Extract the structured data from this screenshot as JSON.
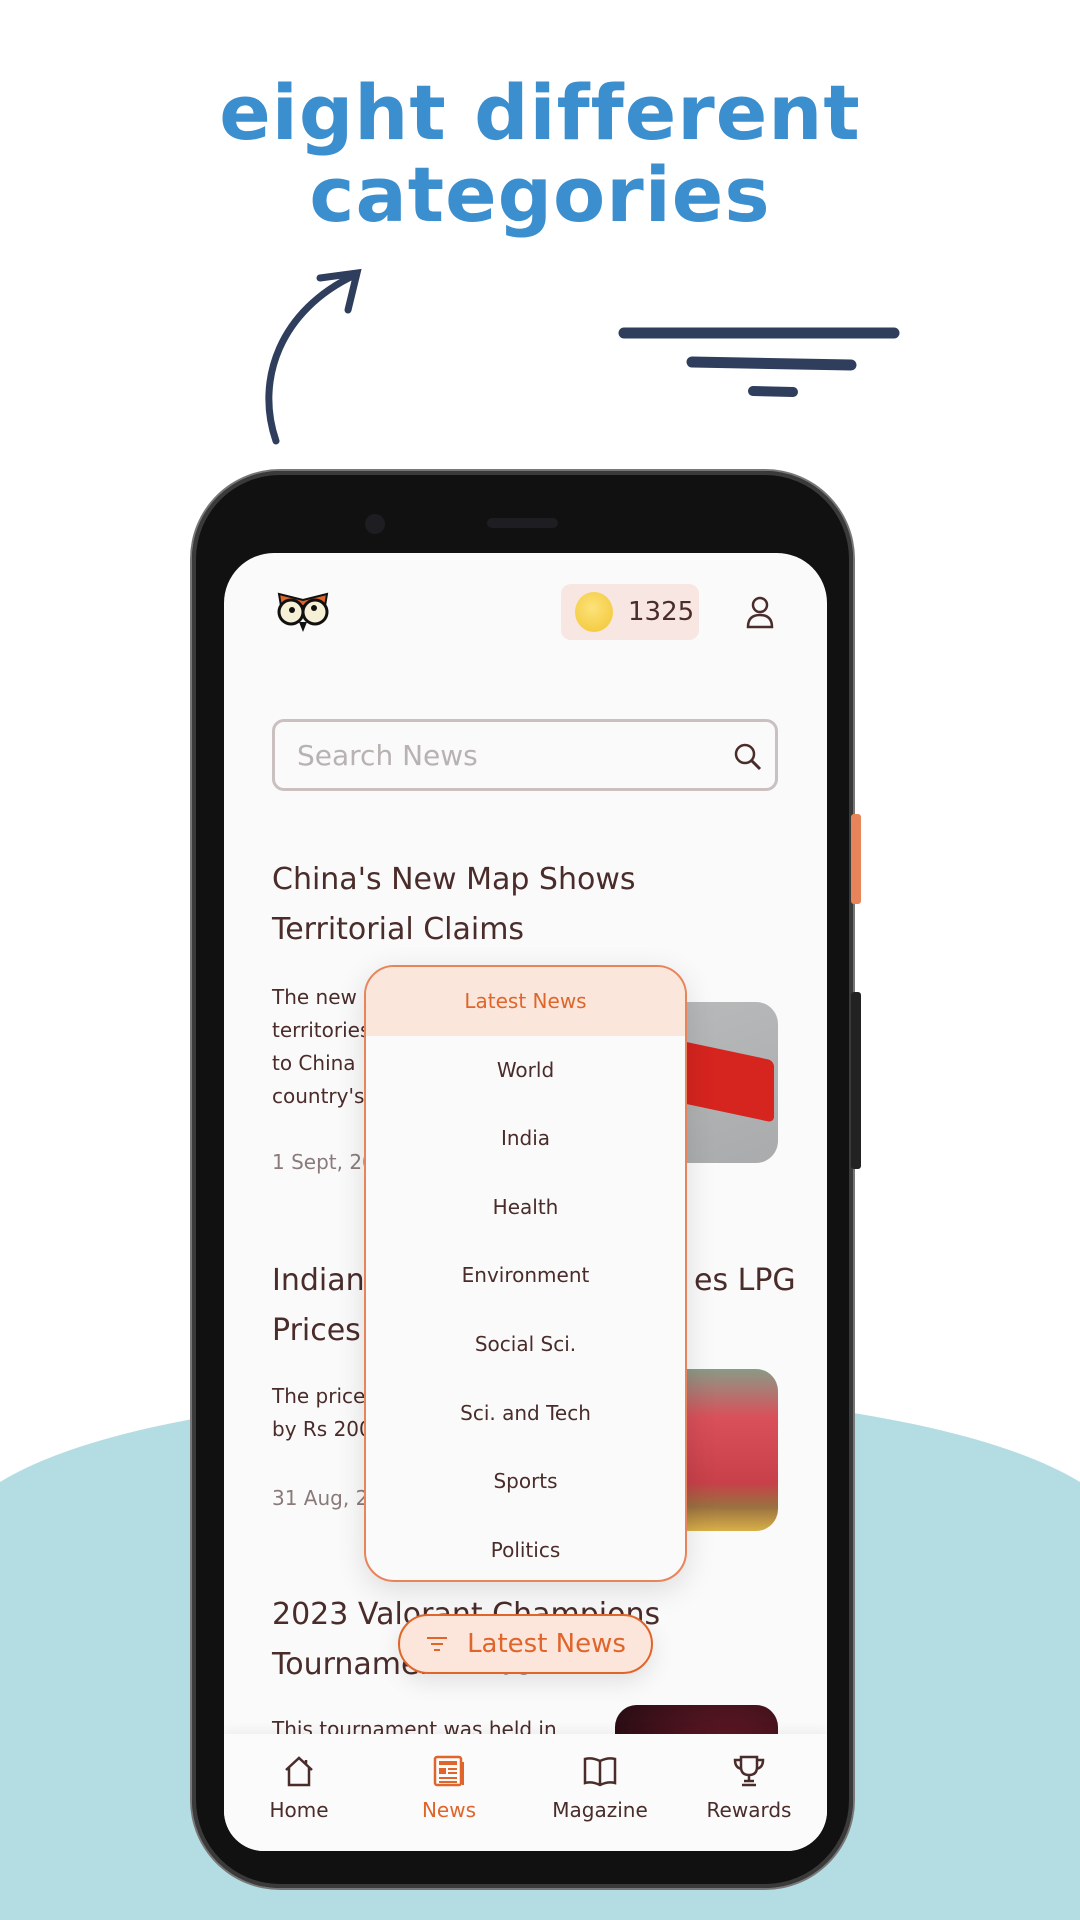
{
  "promo": {
    "headline_line1": "eight different",
    "headline_line2": "categories"
  },
  "app": {
    "coins": "1325",
    "search": {
      "placeholder": "Search News"
    },
    "articles": [
      {
        "title_lines": [
          "China's New Map Shows",
          "Territorial Claims"
        ],
        "body_lines": [
          "The new",
          "territories",
          "to China",
          "country's"
        ],
        "date": "1 Sept, 20"
      },
      {
        "title_lines": [
          "Indian",
          "es LPG",
          "Prices"
        ],
        "body_lines": [
          "The price",
          "by Rs 200"
        ],
        "date": "31 Aug, 2"
      },
      {
        "title_lines": [
          "2023 Valorant Champions",
          "Tournament Ends"
        ],
        "body_lines": [
          "This tournament was held in"
        ]
      }
    ],
    "category_menu": {
      "selected": "Latest News",
      "items": [
        "Latest News",
        "World",
        "India",
        "Health",
        "Environment",
        "Social Sci.",
        "Sci. and Tech",
        "Sports",
        "Politics"
      ]
    },
    "filter_button": {
      "label": "Latest News",
      "icon": "filter-icon"
    },
    "bottom_nav": [
      {
        "label": "Home",
        "icon": "home-icon"
      },
      {
        "label": "News",
        "icon": "newspaper-icon",
        "active": true
      },
      {
        "label": "Magazine",
        "icon": "book-icon"
      },
      {
        "label": "Rewards",
        "icon": "trophy-icon"
      }
    ]
  },
  "colors": {
    "accent": "#e0652a",
    "headline": "#3b8fcf",
    "text": "#4a2c2a",
    "teal_bg": "#b3dde3",
    "doodle": "#2f3e5c"
  }
}
